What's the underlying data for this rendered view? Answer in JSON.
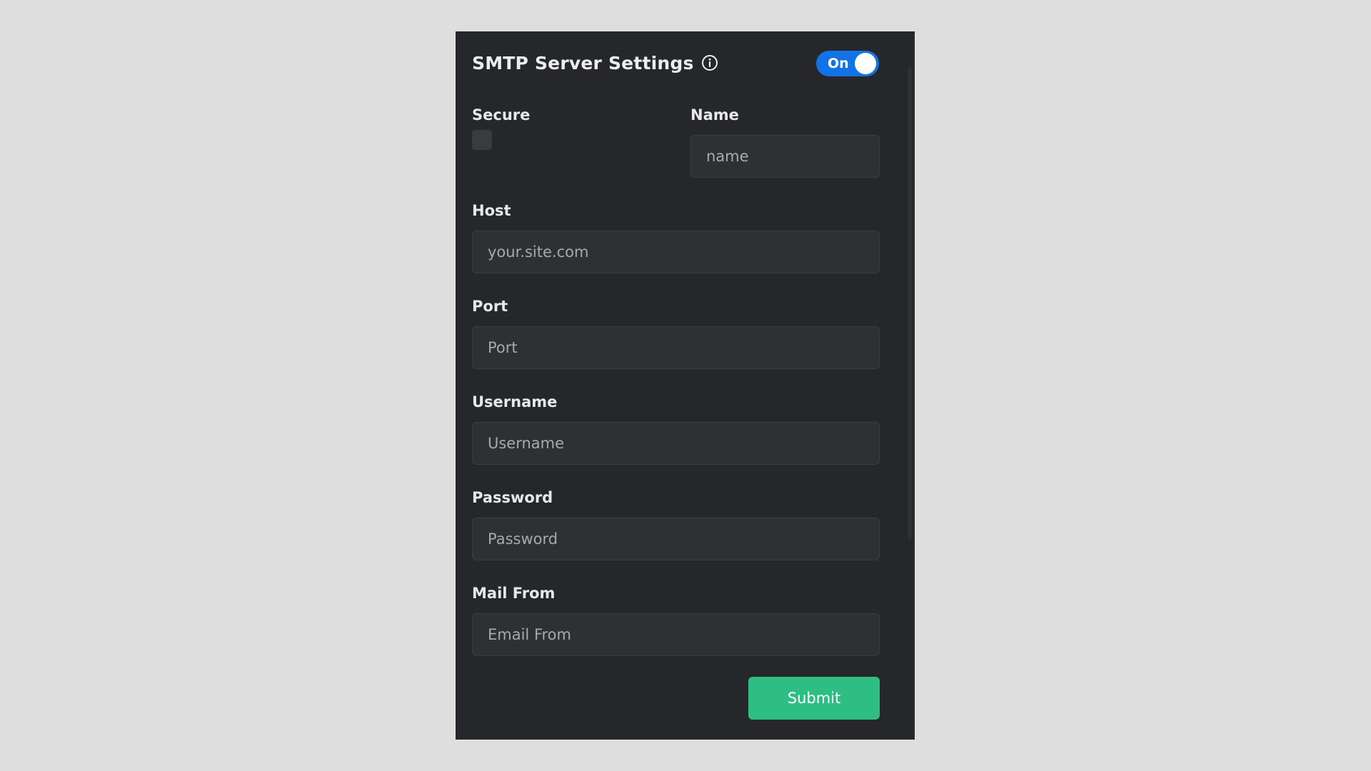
{
  "header": {
    "title": "SMTP Server Settings",
    "info_icon": "info-circle-icon",
    "toggle_label": "On",
    "toggle_state": true
  },
  "form": {
    "secure": {
      "label": "Secure",
      "checked": false
    },
    "name": {
      "label": "Name",
      "placeholder": "name",
      "value": ""
    },
    "host": {
      "label": "Host",
      "placeholder": "your.site.com",
      "value": ""
    },
    "port": {
      "label": "Port",
      "placeholder": "Port",
      "value": ""
    },
    "username": {
      "label": "Username",
      "placeholder": "Username",
      "value": ""
    },
    "password": {
      "label": "Password",
      "placeholder": "Password",
      "value": ""
    },
    "mail_from": {
      "label": "Mail From",
      "placeholder": "Email From",
      "value": ""
    }
  },
  "submit_label": "Submit",
  "colors": {
    "page_background": "#dedede",
    "panel_background": "#26272a",
    "input_background": "#2f3034",
    "toggle_on": "#1273e6",
    "submit_button": "#2ebd82"
  }
}
